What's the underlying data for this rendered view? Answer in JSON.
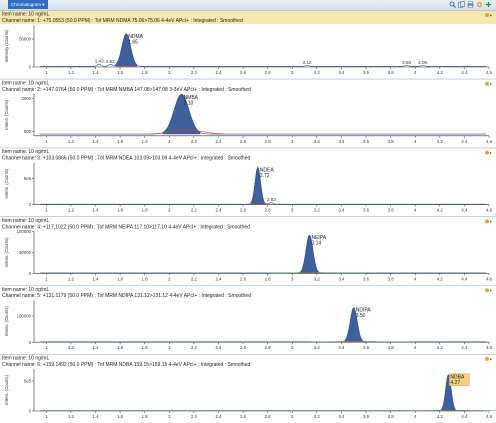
{
  "window": {
    "title": "Chromatogram ▾"
  },
  "toolbar": {
    "icons": [
      "zoom-icon",
      "copy-icon",
      "print-icon",
      "options-icon",
      "pin-icon"
    ]
  },
  "x_ticks": [
    "1",
    "1.2",
    "1.4",
    "1.6",
    "1.8",
    "2",
    "2.2",
    "2.4",
    "2.6",
    "2.8",
    "3",
    "3.2",
    "3.4",
    "3.6",
    "3.8",
    "4",
    "4.2",
    "4.4",
    "4.6"
  ],
  "panels": [
    {
      "item_name": "Item name: 10 ng/mL",
      "channel_name": "Channel name: 1: +75.0553 (50.0 PPM) : Tof MRM NDMA 75.06>75.06 4-4eV APcI+ : Integrated : Smoothed",
      "highlight": true,
      "y_axis_label": "Intensity (Counts)",
      "y_ticks": [
        {
          "label": "50000",
          "value": 50000
        },
        {
          "label": "0",
          "value": 0
        }
      ],
      "y_max": 75000,
      "main_peak": {
        "name": "NDMA",
        "rt": "1.65",
        "x": 1.65,
        "height": 58000,
        "width": 0.035
      },
      "minor_peaks": [
        {
          "x": 1.43,
          "h": 4000,
          "label": "1.43"
        },
        {
          "x": 1.52,
          "h": 3500,
          "label": "1.52"
        },
        {
          "x": 3.12,
          "h": 1500,
          "label": "3.12"
        },
        {
          "x": 3.93,
          "h": 1500,
          "label": "3.93"
        },
        {
          "x": 4.06,
          "h": 1500,
          "label": "4.06"
        }
      ],
      "baseline": 1200
    },
    {
      "item_name": "Item name: 10 ng/mL",
      "channel_name": "Channel name: 2: +147.0764 (50.0 PPM) : Tof MRM NMBA 147.08>147.08 3-3eV APcI+ : Integrated : Smoothed",
      "highlight": false,
      "y_axis_label": "Intens. (Counts)",
      "y_ticks": [
        {
          "label": "2000",
          "value": 2000
        },
        {
          "label": "500",
          "value": 500
        }
      ],
      "y_min": 300,
      "y_max": 2200,
      "main_peak": {
        "name": "NMBA",
        "rt": "2.10",
        "x": 2.1,
        "height": 1800,
        "width": 0.06
      },
      "minor_peaks": [],
      "baseline": 380,
      "red_bump": true
    },
    {
      "item_name": "Item name: 10 ng/mL",
      "channel_name": "Channel name: 3: +103.0866 (50.0 PPM) : Tof MRM NDEA 103.09>103.09 4-4eV APcI+ : Integrated : Smoothed",
      "highlight": false,
      "y_axis_label": "Intens. (Counts)",
      "y_ticks": [
        {
          "label": "5e5",
          "value": 500000
        },
        {
          "label": "0",
          "value": 0
        }
      ],
      "y_max": 800000,
      "main_peak": {
        "name": "NDEA",
        "rt": "2.72",
        "x": 2.72,
        "height": 700000,
        "width": 0.022
      },
      "minor_peaks": [
        {
          "x": 2.83,
          "h": 30000,
          "label": "2.83"
        }
      ],
      "baseline": 8000
    },
    {
      "item_name": "Item name: 10 ng/mL",
      "channel_name": "Channel name: 4: +117.1022 (50.0 PPM) : Tof MRM NEIPA 117.10>117.10 4-4eV APcI+ : Integrated : Smoothed",
      "highlight": false,
      "y_axis_label": "Intens. (Counts)",
      "y_ticks": [
        {
          "label": "100000",
          "value": 100000
        },
        {
          "label": "50000",
          "value": 50000
        },
        {
          "label": "0",
          "value": 0
        }
      ],
      "y_max": 100000,
      "main_peak": {
        "name": "NEIPA",
        "rt": "3.14",
        "x": 3.14,
        "height": 90000,
        "width": 0.028
      },
      "minor_peaks": [],
      "baseline": 1000
    },
    {
      "item_name": "Item name: 10 ng/mL",
      "channel_name": "Channel name: 5: +131.1179 (50.0 PPM) : Tof MRM NDIPA 131.12>131.12 4-4eV APcI+ : Integrated : Smoothed",
      "highlight": false,
      "y_axis_label": "Intens. (Counts)",
      "y_ticks": [
        {
          "label": "100000",
          "value": 100000
        },
        {
          "label": "0",
          "value": 0
        }
      ],
      "y_max": 160000,
      "main_peak": {
        "name": "NDIPA",
        "rt": "3.50",
        "x": 3.5,
        "height": 130000,
        "width": 0.028
      },
      "minor_peaks": [],
      "baseline": 1500
    },
    {
      "item_name": "Item name: 10 ng/mL",
      "channel_name": "Channel name: 6: +159.1492 (50.0 PPM) : Tof MRM NDBA 159.15>159.15 4-4eV APcI+ : Integrated : Smoothed",
      "highlight": false,
      "y_axis_label": "Intens. (Counts)",
      "y_ticks": [
        {
          "label": "5e5",
          "value": 500000
        },
        {
          "label": "0",
          "value": 0
        }
      ],
      "y_max": 700000,
      "main_peak": {
        "name": "NDBA",
        "rt": "4.27",
        "x": 4.27,
        "height": 600000,
        "width": 0.022,
        "label_box": true
      },
      "minor_peaks": [],
      "baseline": 5000
    }
  ],
  "colors": {
    "header_highlight": "#f6e7b0",
    "header_normal": "#ffffff",
    "peak_fill": "#2a4f8f",
    "peak_fill_light": "#9fb6dc",
    "trace": "#2a4f8f",
    "baseline": "#d23c3c",
    "green_trace": "#4f9a3c",
    "label_box": "#f2d27a"
  }
}
